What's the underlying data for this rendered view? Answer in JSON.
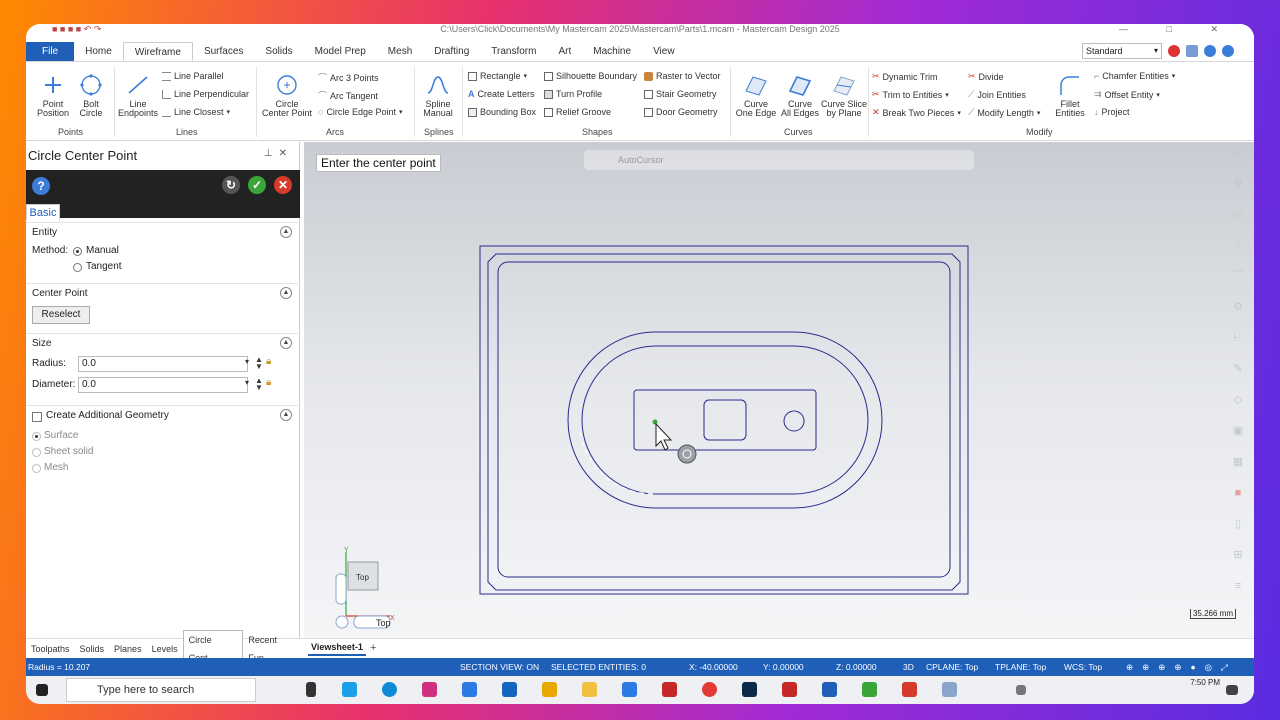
{
  "window": {
    "title": "C:\\Users\\Click\\Documents\\My Mastercam 2025\\Mastercam\\Parts\\1.mcam - Mastercam Design 2025"
  },
  "ribbon": {
    "tabs": [
      "File",
      "Home",
      "Wireframe",
      "Surfaces",
      "Solids",
      "Model Prep",
      "Mesh",
      "Drafting",
      "Transform",
      "Art",
      "Machine",
      "View"
    ],
    "active_tab": "Wireframe",
    "mode_select": "Standard",
    "groups": {
      "points": "Points",
      "lines": "Lines",
      "arcs": "Arcs",
      "splines": "Splines",
      "shapes": "Shapes",
      "curves": "Curves",
      "modify": "Modify"
    },
    "buttons": {
      "point_position": "Point\nPosition",
      "bolt_circle": "Bolt\nCircle",
      "line_endpoints": "Line\nEndpoints",
      "line_parallel": "Line Parallel",
      "line_perpendicular": "Line Perpendicular",
      "line_closest": "Line Closest",
      "circle_center_point": "Circle\nCenter Point",
      "arc_3_points": "Arc 3 Points",
      "arc_tangent": "Arc Tangent",
      "circle_edge_point": "Circle Edge Point",
      "spline_manual": "Spline\nManual",
      "rectangle": "Rectangle",
      "create_letters": "Create Letters",
      "bounding_box": "Bounding Box",
      "silhouette_boundary": "Silhouette Boundary",
      "turn_profile": "Turn Profile",
      "relief_groove": "Relief Groove",
      "raster_to_vector": "Raster to Vector",
      "stair_geometry": "Stair Geometry",
      "door_geometry": "Door Geometry",
      "curve_one_edge": "Curve\nOne Edge",
      "curve_all_edges": "Curve\nAll Edges",
      "curve_slice": "Curve Slice\nby Plane",
      "dynamic_trim": "Dynamic Trim",
      "trim_to_entities": "Trim to Entities",
      "break_two_pieces": "Break Two Pieces",
      "divide": "Divide",
      "join_entities": "Join Entities",
      "modify_length": "Modify Length",
      "fillet_entities": "Fillet\nEntities",
      "chamfer_entities": "Chamfer Entities",
      "offset_entity": "Offset Entity",
      "project": "Project"
    }
  },
  "panel": {
    "title": "Circle Center Point",
    "tab_basic": "Basic",
    "entity": {
      "header": "Entity",
      "method_label": "Method:",
      "option_manual": "Manual",
      "option_tangent": "Tangent",
      "selected": "Manual"
    },
    "center_point": {
      "header": "Center Point",
      "reselect": "Reselect"
    },
    "size": {
      "header": "Size",
      "radius_label": "Radius:",
      "radius_value": "0.0",
      "diameter_label": "Diameter:",
      "diameter_value": "0.0"
    },
    "additional": {
      "header": "Create Additional Geometry",
      "surface": "Surface",
      "sheet_solid": "Sheet solid",
      "mesh": "Mesh"
    }
  },
  "manager_tabs": [
    "Toolpaths",
    "Solids",
    "Planes",
    "Levels",
    "Circle Cent...",
    "Recent Fun..."
  ],
  "viewport": {
    "prompt": "Enter the center point",
    "autocursor": "AutoCursor",
    "gnomon_label": "Top",
    "view_name": "Top",
    "scale": "35.266 mm",
    "sheet_tab": "Viewsheet-1",
    "sheet_add": "+"
  },
  "status_bar": {
    "radius": "Radius = 10.207",
    "section_view": "SECTION VIEW: ON",
    "selected": "SELECTED ENTITIES: 0",
    "x": "X:  -40.00000",
    "y": "Y:  0.00000",
    "z": "Z:  0.00000",
    "mode": "3D",
    "cplane": "CPLANE: Top",
    "tplane": "TPLANE: Top",
    "wcs": "WCS: Top"
  },
  "taskbar": {
    "search_placeholder": "Type here to search",
    "time": "7:50 PM"
  },
  "colors": {
    "accent": "#1f5fb8",
    "geometry": "#2a2a8c",
    "ok": "#3aa63a",
    "cancel": "#d63a2a"
  }
}
